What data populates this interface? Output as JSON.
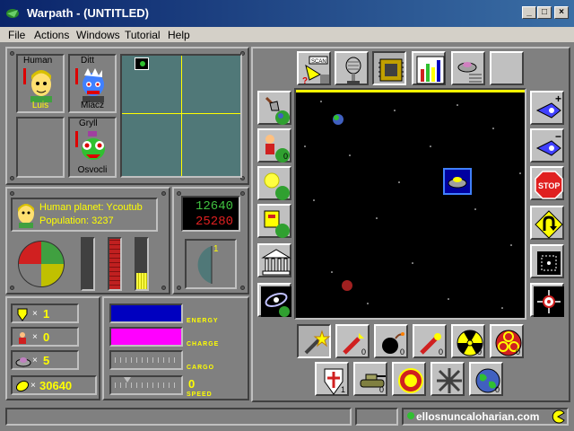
{
  "window": {
    "title": "Warpath - (UNTITLED)"
  },
  "menu": {
    "file": "File",
    "actions": "Actions",
    "windows": "Windows",
    "tutorial": "Tutorial",
    "help": "Help"
  },
  "players": [
    {
      "race": "Human",
      "name": "Luis",
      "color": "#ffff00"
    },
    {
      "race": "Ditt",
      "name": "Miacz",
      "color": "#000000"
    },
    {
      "race": "Gryll",
      "name": "Osvocli",
      "color": "#000000"
    }
  ],
  "planet": {
    "label": "Human planet: Ycoutub",
    "population": "Population: 3237"
  },
  "counters": {
    "green": "12640",
    "red": "25280"
  },
  "gauge": {
    "value": "1"
  },
  "stats": {
    "shields": "1",
    "troops": "0",
    "ships": "5",
    "credits": "30640",
    "x": "×"
  },
  "bars": {
    "energy": {
      "label": "ENERGY",
      "color": "#0000c0",
      "fill": 1.0
    },
    "charge": {
      "label": "CHARGE",
      "color": "#ff00ff",
      "fill": 1.0
    },
    "cargo": {
      "label": "CARGO",
      "fill": 0.0
    },
    "speed": {
      "label": "SPEED",
      "value": "0",
      "fill": 0.15
    }
  },
  "toolbar_top": [
    {
      "name": "scan",
      "text": "SCAN"
    },
    {
      "name": "comm"
    },
    {
      "name": "chip"
    },
    {
      "name": "graph"
    },
    {
      "name": "probe"
    },
    {
      "name": "blank"
    }
  ],
  "weapons": [
    {
      "name": "laser",
      "count": ""
    },
    {
      "name": "missile",
      "count": "0"
    },
    {
      "name": "bomb",
      "count": "0"
    },
    {
      "name": "torpedo",
      "count": "0"
    },
    {
      "name": "nuke",
      "count": "0"
    },
    {
      "name": "bio",
      "count": "0"
    }
  ],
  "bottom_row": [
    {
      "name": "shield-item",
      "count": "1"
    },
    {
      "name": "tank",
      "count": "0"
    },
    {
      "name": "mine",
      "count": ""
    },
    {
      "name": "virus",
      "count": ""
    },
    {
      "name": "planet-item",
      "count": "0"
    }
  ],
  "side_left": [
    {
      "name": "shovel"
    },
    {
      "name": "colonist",
      "count": "0"
    },
    {
      "name": "sun"
    },
    {
      "name": "cargo-box"
    },
    {
      "name": "bank"
    },
    {
      "name": "galaxy"
    }
  ],
  "side_right": [
    {
      "name": "ship-plus",
      "text": "+"
    },
    {
      "name": "ship-minus",
      "text": "−"
    },
    {
      "name": "stop",
      "text": "STOP"
    },
    {
      "name": "uturn"
    },
    {
      "name": "target"
    },
    {
      "name": "station"
    }
  ],
  "watermark": "ellosnuncaloharian.com",
  "colors": {
    "space": "#000000",
    "grid": "#507878",
    "accent": "#ffff00"
  }
}
